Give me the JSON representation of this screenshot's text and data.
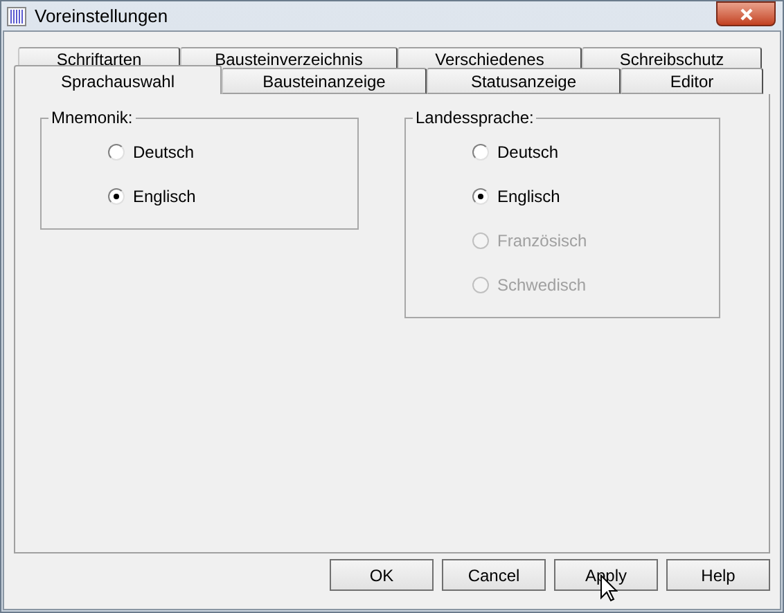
{
  "window": {
    "title": "Voreinstellungen"
  },
  "tab_rows": [
    {
      "tabs": [
        {
          "label": "Schriftarten",
          "selected": false
        },
        {
          "label": "Bausteinverzeichnis",
          "selected": false
        },
        {
          "label": "Verschiedenes",
          "selected": false
        },
        {
          "label": "Schreibschutz",
          "selected": false
        }
      ]
    },
    {
      "tabs": [
        {
          "label": "Sprachauswahl",
          "selected": true
        },
        {
          "label": "Bausteinanzeige",
          "selected": false
        },
        {
          "label": "Statusanzeige",
          "selected": false
        },
        {
          "label": "Editor",
          "selected": false
        }
      ]
    }
  ],
  "groups": [
    {
      "title": "Mnemonik:",
      "options": [
        {
          "label": "Deutsch",
          "selected": false,
          "disabled": false
        },
        {
          "label": "Englisch",
          "selected": true,
          "disabled": false
        }
      ]
    },
    {
      "title": "Landessprache:",
      "options": [
        {
          "label": "Deutsch",
          "selected": false,
          "disabled": false
        },
        {
          "label": "Englisch",
          "selected": true,
          "disabled": false
        },
        {
          "label": "Französisch",
          "selected": false,
          "disabled": true
        },
        {
          "label": "Schwedisch",
          "selected": false,
          "disabled": true
        }
      ]
    }
  ],
  "buttons": [
    "OK",
    "Cancel",
    "Apply",
    "Help"
  ]
}
